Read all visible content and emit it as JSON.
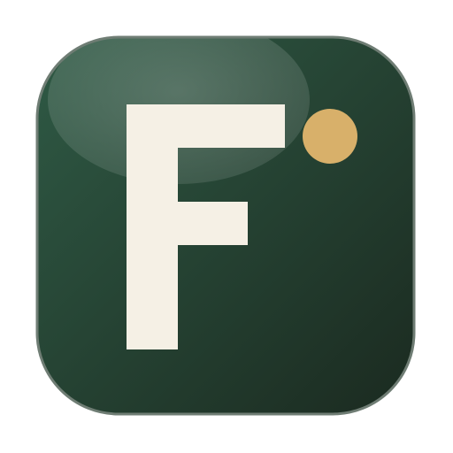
{
  "icon": {
    "name": "app-icon",
    "letter": "F",
    "colors": {
      "background_top_left": "#2f5a45",
      "background_bottom_right": "#1b2a20",
      "border": "#6f7d74",
      "glare": "#ffffff",
      "letter": "#f5f0e5",
      "dot": "#d8b06a"
    }
  }
}
